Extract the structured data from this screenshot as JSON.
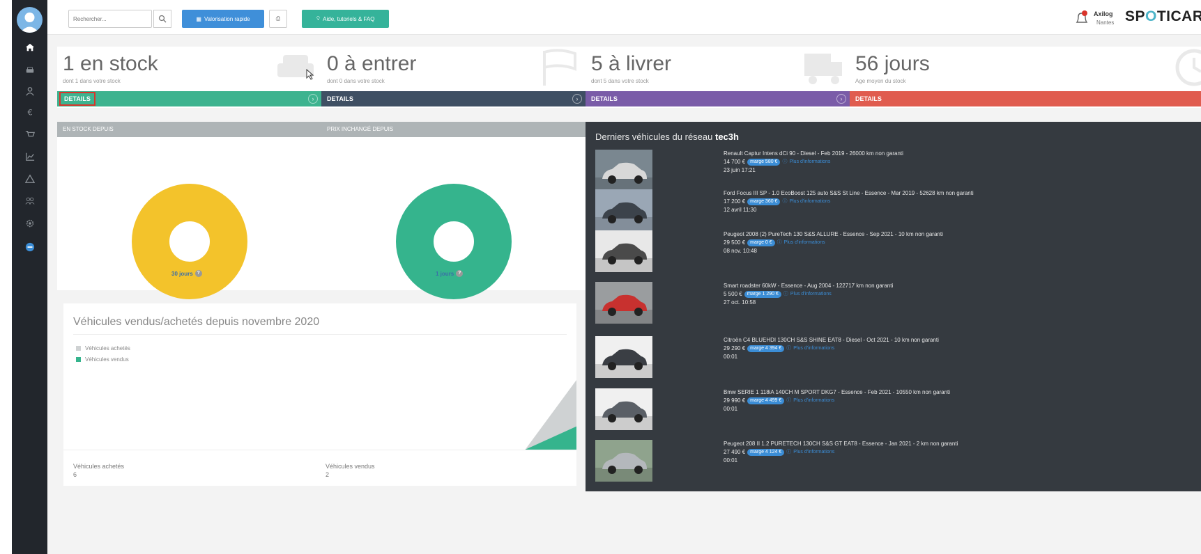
{
  "search": {
    "placeholder": "Rechercher..."
  },
  "toolbar": {
    "valorisation_label": "Valorisation rapide",
    "help_label": "Aide, tutoriels & FAQ"
  },
  "user": {
    "name": "Axilog",
    "city": "Nantes"
  },
  "brand": {
    "logo_text": "SPOTICAR"
  },
  "stats_cards": [
    {
      "title": "1 en stock",
      "subtitle": "dont 1 dans votre stock",
      "details_label": "DETAILS",
      "color": "#3db38f"
    },
    {
      "title": "0 à entrer",
      "subtitle": "dont 0 dans votre stock",
      "details_label": "DETAILS",
      "color": "#3f4f63"
    },
    {
      "title": "5 à livrer",
      "subtitle": "dont 5 dans votre stock",
      "details_label": "DETAILS",
      "color": "#7a5ca8"
    },
    {
      "title": "56 jours",
      "subtitle": "Age moyen du stock",
      "details_label": "DETAILS",
      "color": "#e05c4f"
    }
  ],
  "panels": [
    {
      "header": "EN STOCK DEPUIS",
      "footer": "30 jours",
      "color": "#f3c32b"
    },
    {
      "header": "PRIX INCHANGÉ DEPUIS",
      "footer": "1 jours",
      "color": "#35b48d"
    }
  ],
  "sales": {
    "title": "Véhicules vendus/achetés depuis novembre 2020",
    "legend": [
      {
        "label": "Véhicules achetés",
        "color": "#cfd2d3"
      },
      {
        "label": "Véhicules vendus",
        "color": "#35b48d"
      }
    ],
    "bought_label": "Véhicules achetés",
    "bought_value": "6",
    "sold_label": "Véhicules vendus",
    "sold_value": "2"
  },
  "chart_data": {
    "type": "area",
    "series": [
      {
        "name": "Véhicules achetés",
        "color": "#cfd2d3",
        "values": [
          0,
          0,
          0,
          0,
          0,
          0,
          0,
          0,
          0,
          0,
          6
        ]
      },
      {
        "name": "Véhicules vendus",
        "color": "#35b48d",
        "values": [
          0,
          0,
          0,
          0,
          0,
          0,
          0,
          0,
          0,
          0,
          2
        ]
      }
    ],
    "xlabel": "",
    "ylabel": ""
  },
  "network": {
    "title_prefix": "Derniers véhicules du réseau",
    "title_name": "tec3h",
    "more_label": "Plus d'informations",
    "vehicles": [
      {
        "desc": "Renault Captur Intens dCi 90 - Diesel - Feb 2019 - 26000 km non garanti",
        "price": "14 700 €",
        "margin": "marge 580 €",
        "date": "23 juin 17:21",
        "car_color": "#d8d8d8",
        "bg": "#7a8790"
      },
      {
        "desc": "Ford Focus III SP - 1.0 EcoBoost 125 auto S&S St Line - Essence - Mar 2019 - 52628 km non garanti",
        "price": "17 200 €",
        "margin": "marge 360 €",
        "date": "12 avril 11:30",
        "car_color": "#3c434b",
        "bg": "#9aa7b5"
      },
      {
        "desc": "Peugeot 2008 (2) PureTech 130 S&S ALLURE - Essence - Sep 2021 - 10 km non garanti",
        "price": "29 500 €",
        "margin": "marge 0 €",
        "date": "08 nov. 10:48",
        "car_color": "#4a4a4a",
        "bg": "#e8e8e8"
      },
      {
        "desc": "Smart roadster 60kW - Essence - Aug 2004 - 122717 km non garanti",
        "price": "5 500 €",
        "margin": "marge 1 290 €",
        "date": "27 oct. 10:58",
        "car_color": "#c8312f",
        "bg": "#9a9d9f"
      },
      {
        "desc": "Citroën C4 BLUEHDI 130CH S&S SHINE EAT8 - Diesel - Oct 2021 - 10 km non garanti",
        "price": "29 290 €",
        "margin": "marge 4 394 €",
        "date": "00:01",
        "car_color": "#3a3e44",
        "bg": "#f0f0f0"
      },
      {
        "desc": "Bmw SERIE 1 118iA 140CH M SPORT DKG7 - Essence - Feb 2021 - 10550 km non garanti",
        "price": "29 990 €",
        "margin": "marge 4 499 €",
        "date": "00:01",
        "car_color": "#5a5f66",
        "bg": "#f0f0f0"
      },
      {
        "desc": "Peugeot 208 II 1.2 PURETECH 130CH S&S GT EAT8 - Essence - Jan 2021 - 2 km non garanti",
        "price": "27 490 €",
        "margin": "marge 4 124 €",
        "date": "00:01",
        "car_color": "#b4b8bc",
        "bg": "#8fa38d"
      }
    ]
  }
}
